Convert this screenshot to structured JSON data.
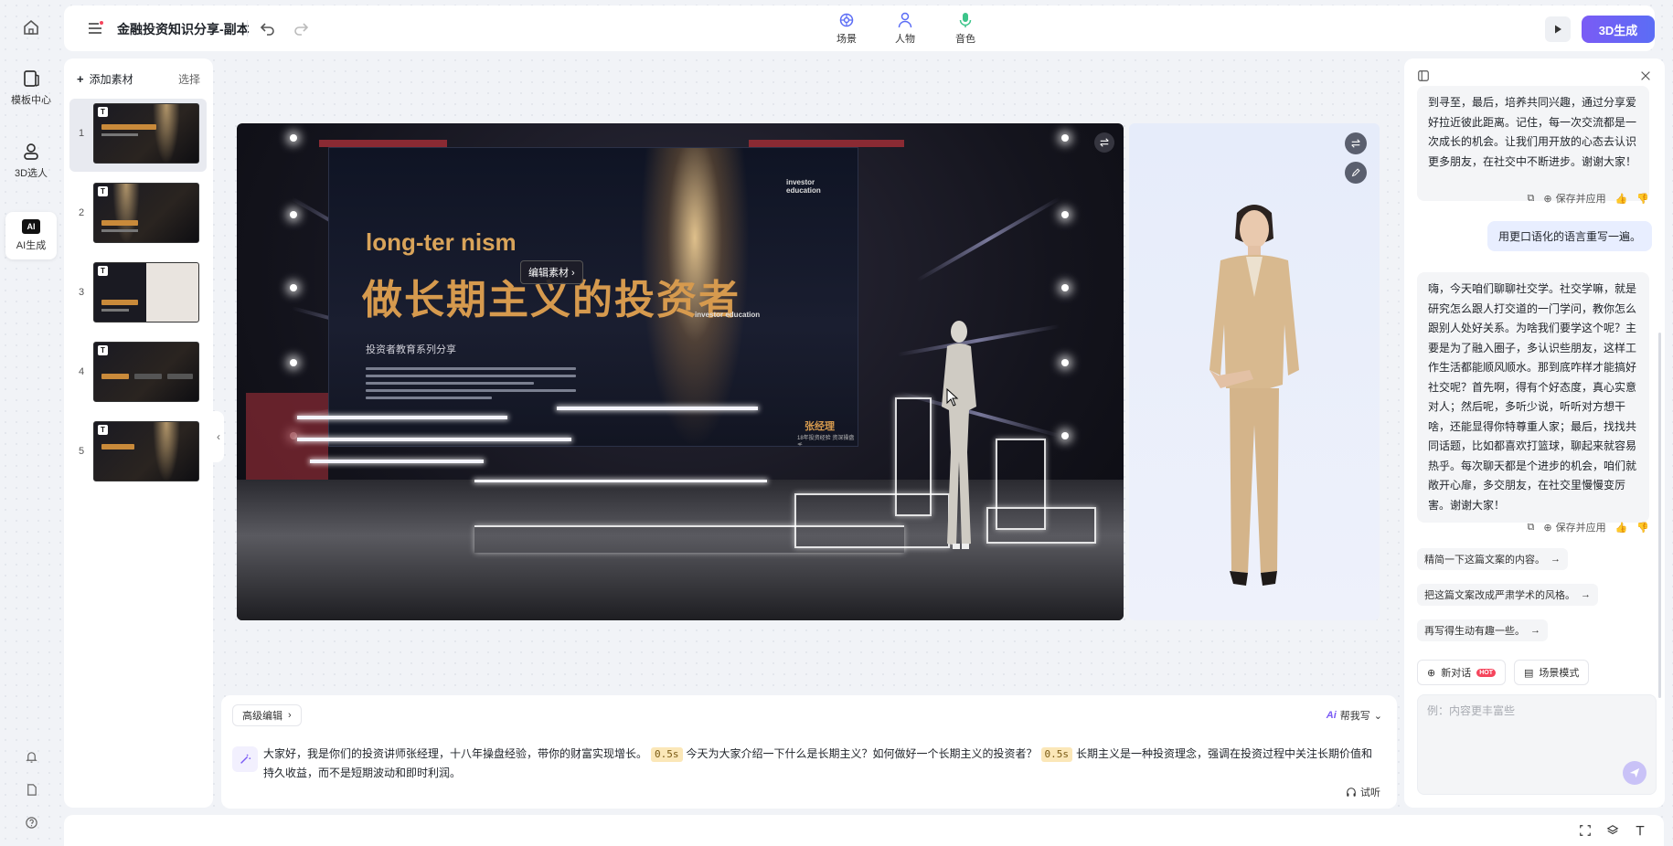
{
  "rail": {
    "template_center": "模板中心",
    "avatar_3d": "3D选人",
    "ai_generate": "AI生成",
    "ai_badge": "AI"
  },
  "topbar": {
    "title": "金融投资知识分享-副本",
    "tabs": [
      {
        "label": "场景",
        "icon": "scene-icon"
      },
      {
        "label": "人物",
        "icon": "person-icon"
      },
      {
        "label": "音色",
        "icon": "microphone-icon"
      }
    ],
    "generate_label": "3D生成"
  },
  "slides": {
    "add_label": "添加素材",
    "select_label": "选择",
    "items": [
      {
        "num": "1",
        "active": true
      },
      {
        "num": "2",
        "active": false
      },
      {
        "num": "3",
        "active": false
      },
      {
        "num": "4",
        "active": false
      },
      {
        "num": "5",
        "active": false
      }
    ]
  },
  "stage": {
    "en_title": "long-ter   nism",
    "cn_title": "做长期主义的投资者",
    "subtitle": "投资者教育系列分享",
    "badge_top": "investor education",
    "badge_mid": "investor education",
    "presenter_name": "张经理",
    "presenter_desc": "18年投资经验 资深操盘手",
    "edit_chip": "编辑素材"
  },
  "editor": {
    "advanced_label": "高级编辑",
    "help_ai": "Ai",
    "help_label": "帮我写",
    "segments": [
      {
        "text": "大家好，我是你们的投资讲师张经理，十八年操盘经验，带你的财富实现增长。"
      },
      {
        "pause": "0.5s"
      },
      {
        "text": "今天为大家介绍一下什么是长期主义？如何做好一个长期主义的投资者？"
      },
      {
        "pause": "0.5s"
      },
      {
        "text": "长期主义是一种投资理念，强调在投资过程中关注长期价值和持久收益，而不是短期波动和即时利润。"
      }
    ],
    "listen_label": "试听"
  },
  "chat": {
    "msg1": "到寻至，最后，培养共同兴趣，通过分享爱好拉近彼此距离。记住，每一次交流都是一次成长的机会。让我们用开放的心态去认识更多朋友，在社交中不断进步。谢谢大家！",
    "save_apply": "保存并应用",
    "user_msg": "用更口语化的语言重写一遍。",
    "msg2": "嗨，今天咱们聊聊社交学。社交学嘛，就是研究怎么跟人打交道的一门学问，教你怎么跟别人处好关系。为啥我们要学这个呢？主要是为了融入圈子，多认识些朋友，这样工作生活都能顺风顺水。那到底咋样才能搞好社交呢？首先啊，得有个好态度，真心实意对人；然后呢，多听少说，听听对方想干啥，还能显得你特尊重人家；最后，找找共同话题，比如都喜欢打篮球，聊起来就容易热乎。每次聊天都是个进步的机会，咱们就敞开心扉，多交朋友，在社交里慢慢变厉害。谢谢大家！",
    "suggestions": [
      "精简一下这篇文案的内容。",
      "把这篇文案改成严肃学术的风格。",
      "再写得生动有趣一些。"
    ],
    "new_chat": "新对话",
    "hot": "HOT",
    "scene_mode": "场景模式",
    "input_placeholder": "例：内容更丰富些"
  },
  "colors": {
    "accent": "#6a5cf5",
    "pause_bg": "#fbe7b8",
    "title_gold": "#d69a4e"
  }
}
